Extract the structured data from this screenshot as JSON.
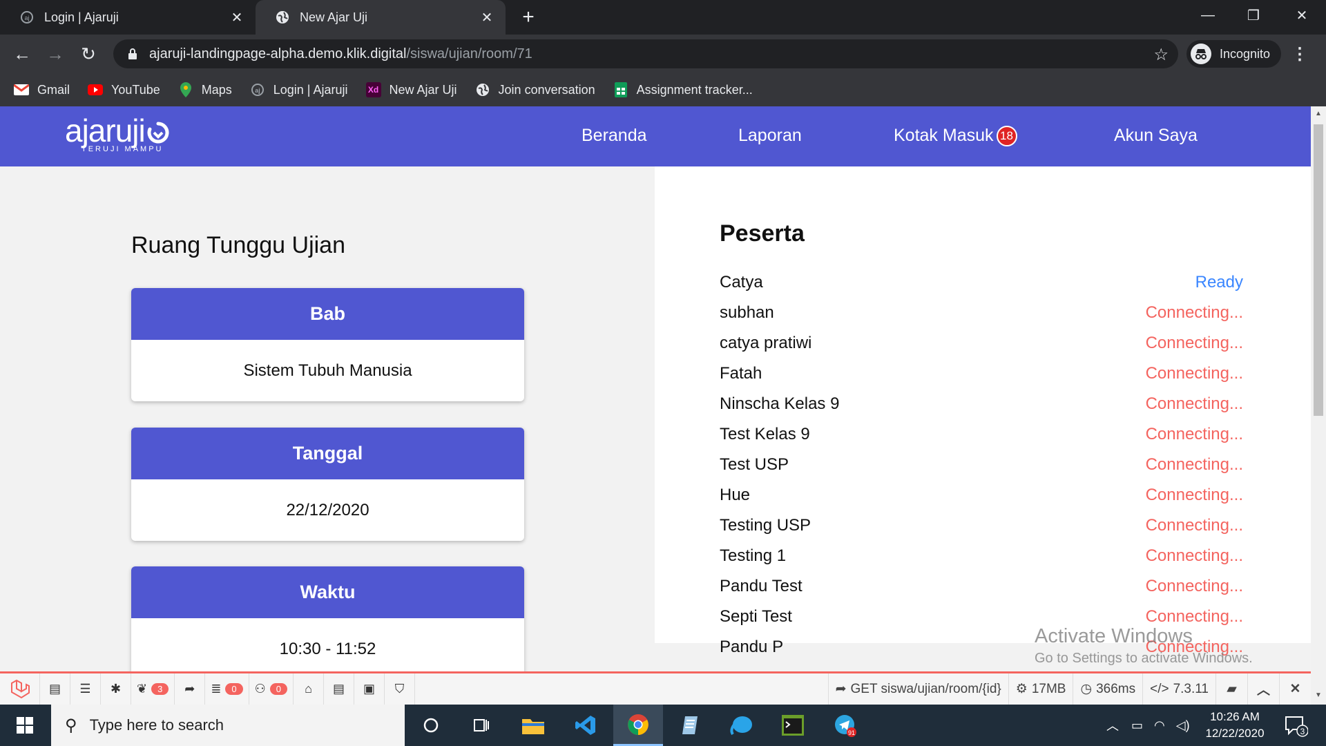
{
  "browser": {
    "tabs": [
      {
        "title": "Login | Ajaruji",
        "favicon": "ajaruji-icon",
        "active": false
      },
      {
        "title": "New Ajar Uji",
        "favicon": "globe-icon",
        "active": true
      }
    ],
    "url_domain": "ajaruji-landingpage-alpha.demo.klik.digital",
    "url_path": "/siswa/ujian/room/71",
    "profile_label": "Incognito",
    "bookmarks": [
      {
        "label": "Gmail",
        "icon": "gmail-icon",
        "color": "#ea4335"
      },
      {
        "label": "YouTube",
        "icon": "youtube-icon",
        "color": "#ff0000"
      },
      {
        "label": "Maps",
        "icon": "maps-icon",
        "color": "#34a853"
      },
      {
        "label": "Login | Ajaruji",
        "icon": "ajaruji-icon",
        "color": "#9aa0a6"
      },
      {
        "label": "New Ajar Uji",
        "icon": "xd-icon",
        "color": "#470137"
      },
      {
        "label": "Join conversation",
        "icon": "globe-icon",
        "color": "#e8eaed"
      },
      {
        "label": "Assignment tracker...",
        "icon": "sheets-icon",
        "color": "#0f9d58"
      }
    ]
  },
  "site": {
    "logo_text": "ajaruji",
    "logo_tagline": "TERUJI MAMPU",
    "nav": [
      {
        "label": "Beranda"
      },
      {
        "label": "Laporan"
      },
      {
        "label": "Kotak Masuk",
        "badge": "18"
      },
      {
        "label": "Akun Saya"
      }
    ],
    "brand_color": "#5057d1"
  },
  "room": {
    "title": "Ruang Tunggu Ujian",
    "cards": [
      {
        "heading": "Bab",
        "value": "Sistem Tubuh Manusia"
      },
      {
        "heading": "Tanggal",
        "value": "22/12/2020"
      },
      {
        "heading": "Waktu",
        "value": "10:30 - 11:52"
      }
    ]
  },
  "participants": {
    "title": "Peserta",
    "ready_color": "#3a86ff",
    "connecting_color": "#f4645f",
    "list": [
      {
        "name": "Catya",
        "status": "Ready",
        "state": "ready"
      },
      {
        "name": "subhan",
        "status": "Connecting...",
        "state": "connecting"
      },
      {
        "name": "catya pratiwi",
        "status": "Connecting...",
        "state": "connecting"
      },
      {
        "name": "Fatah",
        "status": "Connecting...",
        "state": "connecting"
      },
      {
        "name": "Ninscha Kelas 9",
        "status": "Connecting...",
        "state": "connecting"
      },
      {
        "name": "Test Kelas 9",
        "status": "Connecting...",
        "state": "connecting"
      },
      {
        "name": "Test USP",
        "status": "Connecting...",
        "state": "connecting"
      },
      {
        "name": "Hue",
        "status": "Connecting...",
        "state": "connecting"
      },
      {
        "name": "Testing USP",
        "status": "Connecting...",
        "state": "connecting"
      },
      {
        "name": "Testing 1",
        "status": "Connecting...",
        "state": "connecting"
      },
      {
        "name": "Pandu Test",
        "status": "Connecting...",
        "state": "connecting"
      },
      {
        "name": "Septi Test",
        "status": "Connecting...",
        "state": "connecting"
      },
      {
        "name": "Pandu P",
        "status": "Connecting...",
        "state": "connecting"
      }
    ]
  },
  "watermark": {
    "title": "Activate Windows",
    "subtitle": "Go to Settings to activate Windows."
  },
  "debugbar": {
    "badges": {
      "routes": "3",
      "queries": "0",
      "models": "0"
    },
    "request": "GET siswa/ujian/room/{id}",
    "memory": "17MB",
    "time": "366ms",
    "php_version": "7.3.11"
  },
  "taskbar": {
    "search_placeholder": "Type here to search",
    "time": "10:26 AM",
    "date": "12/22/2020",
    "telegram_badge": "91",
    "notification_count": "3"
  }
}
